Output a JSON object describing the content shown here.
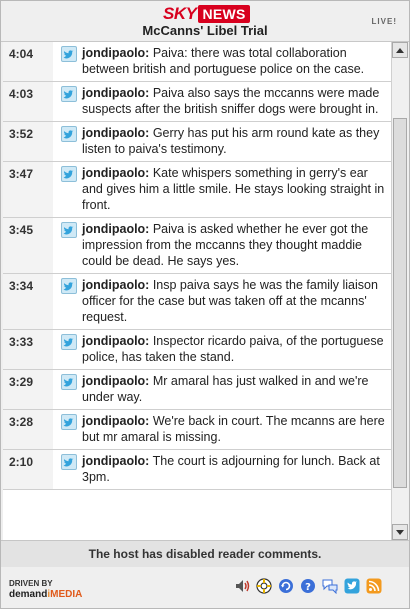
{
  "header": {
    "logo_sky": "SKY",
    "logo_news": "NEWS",
    "title": "McCanns' Libel Trial",
    "live_label": "LIVE!"
  },
  "entries": [
    {
      "time": "4:04",
      "user": "jondipaolo:",
      "text": " Paiva: there was total collaboration between british and portuguese police on the case."
    },
    {
      "time": "4:03",
      "user": "jondipaolo:",
      "text": " Paiva also says the mccanns were made suspects after the british sniffer dogs were brought in."
    },
    {
      "time": "3:52",
      "user": "jondipaolo:",
      "text": " Gerry has put his arm round kate as they listen to paiva's testimony."
    },
    {
      "time": "3:47",
      "user": "jondipaolo:",
      "text": " Kate whispers something in gerry's ear and gives him a little smile. He stays looking straight in front."
    },
    {
      "time": "3:45",
      "user": "jondipaolo:",
      "text": " Paiva is asked whether he ever got the impression from the mccanns they thought maddie could be dead. He says yes."
    },
    {
      "time": "3:34",
      "user": "jondipaolo:",
      "text": " Insp paiva says he was the family liaison officer for the case but was taken off at the mcanns' request."
    },
    {
      "time": "3:33",
      "user": "jondipaolo:",
      "text": " Inspector ricardo paiva, of the portuguese police, has taken the stand."
    },
    {
      "time": "3:29",
      "user": "jondipaolo:",
      "text": " Mr amaral has just walked in and we're under way."
    },
    {
      "time": "3:28",
      "user": "jondipaolo:",
      "text": " We're back in court. The mcanns are here but mr amaral is missing."
    },
    {
      "time": "2:10",
      "user": "jondipaolo:",
      "text": " The court is adjourning for lunch. Back at 3pm."
    }
  ],
  "notice": "The host has disabled reader comments.",
  "footer": {
    "driven_by": "DRIVEN BY",
    "brand_demand": "demand",
    "brand_i": "i",
    "brand_media": "MEDIA"
  },
  "footer_icons": [
    "speaker-icon",
    "lifebuoy-icon",
    "refresh-icon",
    "help-icon",
    "comments-icon",
    "twitter-icon",
    "rss-icon"
  ],
  "colors": {
    "brand_red": "#d8001e",
    "twitter_blue": "#33a3dc",
    "rss_orange": "#f39a1e"
  }
}
